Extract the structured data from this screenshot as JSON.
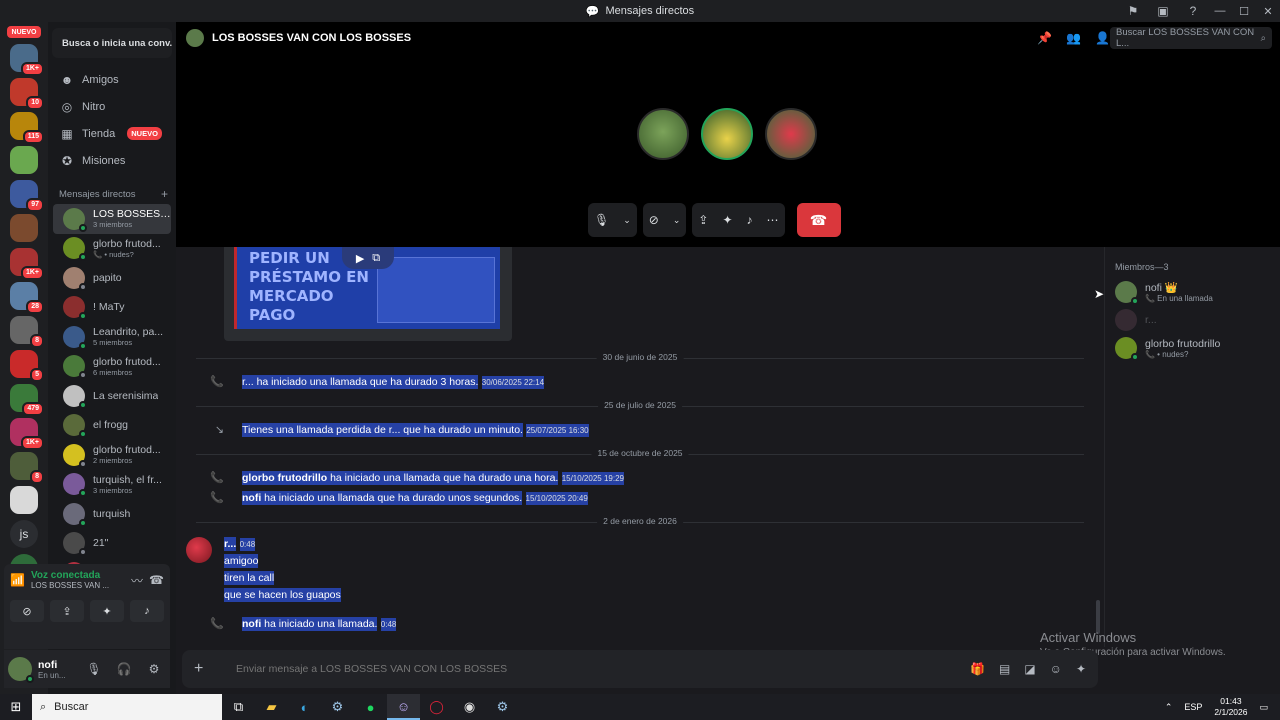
{
  "window": {
    "title": "Mensajes directos"
  },
  "servers": {
    "new_label": "NUEVO",
    "items": [
      {
        "badge": "1K+",
        "color": "#4a6b8a"
      },
      {
        "badge": "10",
        "color": "#c0392b"
      },
      {
        "badge": "115",
        "color": "#b8860b"
      },
      {
        "badge": "",
        "color": "#6aa84f"
      },
      {
        "badge": "97",
        "color": "#3d5a9e"
      },
      {
        "badge": "",
        "color": "#7b4a2e"
      },
      {
        "badge": "1K+",
        "color": "#a83232"
      },
      {
        "badge": "28",
        "color": "#5b7fa6"
      },
      {
        "badge": "8",
        "color": "#666666"
      },
      {
        "badge": "5",
        "color": "#c92a2a"
      },
      {
        "badge": "479",
        "color": "#3a7a3a"
      },
      {
        "badge": "1K+",
        "color": "#b03060"
      },
      {
        "badge": "8",
        "color": "#4e5d3a"
      },
      {
        "badge": "",
        "color": "#d9d9d9"
      }
    ],
    "text_items": [
      {
        "label": "js",
        "badge": ""
      },
      {
        "label": "",
        "badge": "2K+"
      },
      {
        "label": "y",
        "badge": ""
      }
    ]
  },
  "sidebar": {
    "search_label": "Busca o inicia una conv...",
    "nav": [
      {
        "label": "Amigos",
        "icon": "friends-icon",
        "glyph": "☻",
        "badge": ""
      },
      {
        "label": "Nitro",
        "icon": "nitro-icon",
        "glyph": "◎",
        "badge": ""
      },
      {
        "label": "Tienda",
        "icon": "shop-icon",
        "glyph": "▦",
        "badge": "NUEVO"
      },
      {
        "label": "Misiones",
        "icon": "quests-icon",
        "glyph": "✪",
        "badge": ""
      }
    ],
    "dm_header": "Mensajes directos",
    "dms": [
      {
        "name": "LOS BOSSES ...",
        "sub": "3 miembros",
        "active": true,
        "color": "#5b7a4a"
      },
      {
        "name": "glorbo frutod...",
        "sub": "📞 • nudes?",
        "active": false,
        "color": "#6b8e23"
      },
      {
        "name": "papito",
        "sub": "",
        "active": false,
        "color": "#a08070"
      },
      {
        "name": "! MaTy",
        "sub": "",
        "active": false,
        "color": "#8b2e2e"
      },
      {
        "name": "Leandrito, pa...",
        "sub": "5 miembros",
        "active": false,
        "color": "#3a5a8a"
      },
      {
        "name": "glorbo frutod...",
        "sub": "6 miembros",
        "active": false,
        "color": "#4a7a3a"
      },
      {
        "name": "La serenisima",
        "sub": "",
        "active": false,
        "color": "#c0c0c0"
      },
      {
        "name": "el frogg",
        "sub": "",
        "active": false,
        "color": "#5a6a3a"
      },
      {
        "name": "glorbo frutod...",
        "sub": "2 miembros",
        "active": false,
        "color": "#d4c020"
      },
      {
        "name": "turquish, el fr...",
        "sub": "3 miembros",
        "active": false,
        "color": "#7a5a9a"
      },
      {
        "name": "turquish",
        "sub": "",
        "active": false,
        "color": "#6a6a7a"
      },
      {
        "name": "21\"",
        "sub": "",
        "active": false,
        "color": "#4a4a4a"
      },
      {
        "name": "r...",
        "sub": "",
        "active": false,
        "color": "#b03040"
      }
    ]
  },
  "voice": {
    "status": "Voz conectada",
    "channel": "LOS BOSSES VAN ..."
  },
  "user": {
    "name": "nofi",
    "status": "En un..."
  },
  "call": {
    "title": "LOS BOSSES VAN CON LOS BOSSES",
    "search_placeholder": "Buscar LOS BOSSES VAN CON L..."
  },
  "chat": {
    "video_text": "PEDIR UN PRÉSTAMO EN MERCADO PAGO",
    "dividers": [
      "30 de junio de 2025",
      "25 de julio de 2025",
      "15 de octubre de 2025",
      "2 de enero de 2026"
    ],
    "sys": [
      {
        "actor": "",
        "text": "r... ha iniciado una llamada que ha durado 3 horas.",
        "time": "30/06/2025 22:14",
        "missed": false
      },
      {
        "actor": "",
        "text": "Tienes una llamada perdida de r... que ha durado un minuto.",
        "time": "25/07/2025 16:30",
        "missed": true
      },
      {
        "actor": "glorbo frutodrillo",
        "text": " ha iniciado una llamada que ha durado una hora.",
        "time": "15/10/2025 19:29",
        "missed": false
      },
      {
        "actor": "nofi",
        "text": " ha iniciado una llamada que ha durado unos segundos.",
        "time": "15/10/2025 20:49",
        "missed": false
      }
    ],
    "message": {
      "author": "r...",
      "time": "0:48",
      "lines": [
        "amigoo",
        "tiren la call",
        "que se hacen los guapos"
      ]
    },
    "last_sys": {
      "actor": "nofi",
      "text": " ha iniciado una llamada.",
      "time": "0:48"
    },
    "composer_placeholder": "Enviar mensaje a LOS BOSSES VAN CON LOS BOSSES"
  },
  "members": {
    "title": "Miembros—3",
    "list": [
      {
        "name": "nofi 👑",
        "sub": "📞 En una llamada",
        "color": "#5b7a4a"
      },
      {
        "name": "r...",
        "sub": "",
        "color": "#6a4a5a"
      },
      {
        "name": "glorbo frutodrillo",
        "sub": "📞 • nudes?",
        "color": "#6b8e23"
      }
    ]
  },
  "watermark": {
    "title": "Activar Windows",
    "sub": "Ve a Configuración para activar Windows."
  },
  "taskbar": {
    "search": "Buscar",
    "lang": "ESP",
    "time": "01:43",
    "date": "2/1/2026"
  }
}
